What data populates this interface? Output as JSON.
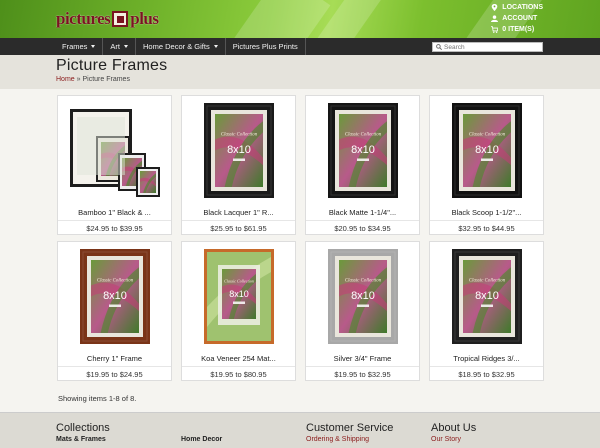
{
  "brand": {
    "logo_word1": "pictures",
    "logo_word2": "plus",
    "accent": "#7a1420",
    "green": "#6fb22a"
  },
  "util_links": [
    {
      "icon": "map-pin-icon",
      "label": "LOCATIONS"
    },
    {
      "icon": "user-icon",
      "label": "ACCOUNT"
    },
    {
      "icon": "cart-icon",
      "label": "0 ITEM(S)"
    }
  ],
  "nav": {
    "items": [
      {
        "label": "Frames",
        "dropdown": true
      },
      {
        "label": "Art",
        "dropdown": true
      },
      {
        "label": "Home Decor & Gifts",
        "dropdown": true
      },
      {
        "label": "Pictures Plus Prints",
        "dropdown": false
      }
    ],
    "search_placeholder": "Search"
  },
  "page": {
    "title": "Picture Frames",
    "breadcrumb_home": "Home",
    "breadcrumb_sep": " » ",
    "breadcrumb_current": "Picture Frames"
  },
  "products": [
    {
      "name": "Bamboo 1\" Black & ...",
      "price": "$24.95 to $39.95",
      "frame_color": "#222",
      "style": "multi"
    },
    {
      "name": "Black Lacquer 1\" R...",
      "price": "$25.95 to $61.95",
      "frame_color": "#1a1a1a",
      "style": "single"
    },
    {
      "name": "Black Matte 1-1/4\"...",
      "price": "$20.95 to $34.95",
      "frame_color": "#151515",
      "style": "single"
    },
    {
      "name": "Black Scoop 1-1/2\"...",
      "price": "$32.95 to $44.95",
      "frame_color": "#111",
      "style": "single"
    },
    {
      "name": "Cherry 1\" Frame",
      "price": "$19.95 to $24.95",
      "frame_color": "#7a3418",
      "style": "single"
    },
    {
      "name": "Koa Veneer 254 Mat...",
      "price": "$19.95 to $80.95",
      "frame_color": "#c66a2a",
      "style": "koa"
    },
    {
      "name": "Silver 3/4\" Frame",
      "price": "$19.95 to $32.95",
      "frame_color": "#a8a8a8",
      "style": "single"
    },
    {
      "name": "Tropical Ridges 3/...",
      "price": "$18.95 to $32.95",
      "frame_color": "#1f1f1f",
      "style": "single"
    }
  ],
  "print_label": "8x10",
  "print_caption": "Classic Collection",
  "showing": "Showing items 1-8 of 8.",
  "footer": {
    "collections": {
      "heading": "Collections",
      "link1": "Mats & Frames",
      "link2": "Home Decor"
    },
    "service": {
      "heading": "Customer Service",
      "link": "Ordering & Shipping"
    },
    "about": {
      "heading": "About Us",
      "link": "Our Story"
    }
  }
}
